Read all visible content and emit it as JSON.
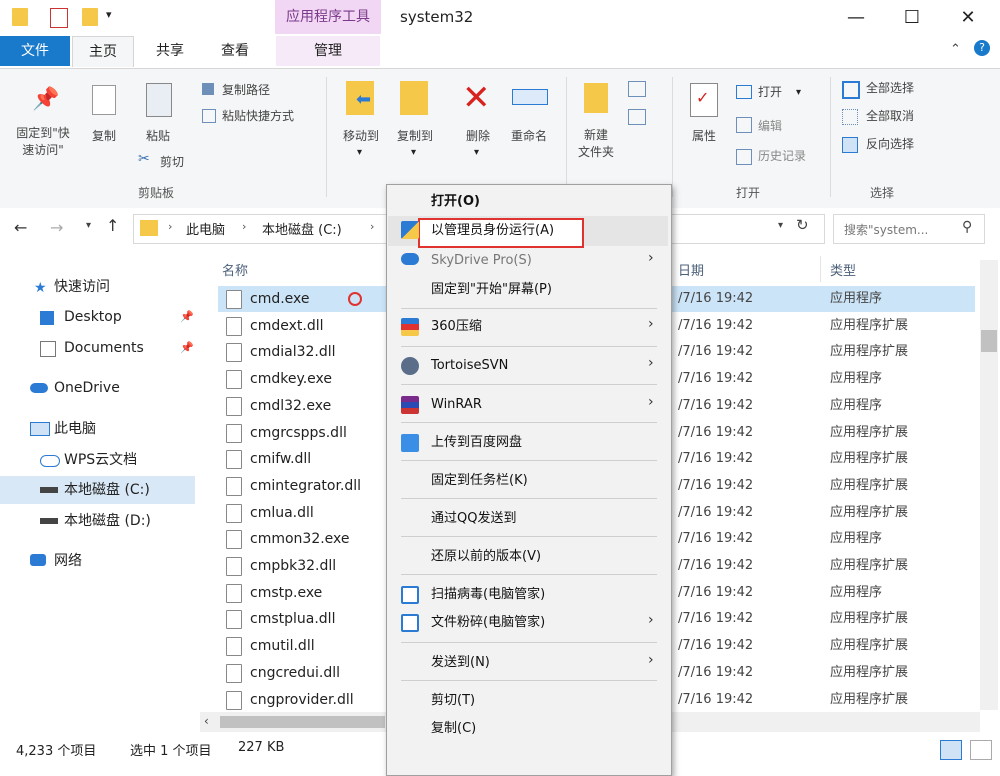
{
  "window": {
    "context_tab_title": "应用程序工具",
    "title": "system32",
    "minimize": "—",
    "maximize": "☐",
    "close": "✕"
  },
  "tabs": {
    "file": "文件",
    "home": "主页",
    "share": "共享",
    "view": "查看",
    "manage": "管理"
  },
  "ribbon": {
    "pin_quick_access": "固定到\"快\n速访问\"",
    "copy": "复制",
    "paste": "粘贴",
    "copy_path": "复制路径",
    "paste_shortcut": "粘贴快捷方式",
    "cut": "剪切",
    "clipboard_group": "剪贴板",
    "move_to": "移动到",
    "copy_to": "复制到",
    "delete": "删除",
    "rename": "重命名",
    "new_folder": "新建\n文件夹",
    "properties": "属性",
    "open": "打开",
    "edit": "编辑",
    "history": "历史记录",
    "open_group": "打开",
    "select_all": "全部选择",
    "select_none": "全部取消",
    "invert_selection": "反向选择",
    "select_group": "选择"
  },
  "address": {
    "crumb_pc": "此电脑",
    "crumb_drive": "本地磁盘 (C:)",
    "search_placeholder": "搜索\"system..."
  },
  "nav": {
    "quick_access": "快速访问",
    "desktop": "Desktop",
    "documents": "Documents",
    "onedrive": "OneDrive",
    "this_pc": "此电脑",
    "wps": "WPS云文档",
    "c_drive": "本地磁盘 (C:)",
    "d_drive": "本地磁盘 (D:)",
    "network": "网络"
  },
  "columns": {
    "name": "名称",
    "date": "日期",
    "type": "类型"
  },
  "files": [
    {
      "name": "cmd.exe",
      "date": "/7/16 19:42",
      "type": "应用程序"
    },
    {
      "name": "cmdext.dll",
      "date": "/7/16 19:42",
      "type": "应用程序扩展"
    },
    {
      "name": "cmdial32.dll",
      "date": "/7/16 19:42",
      "type": "应用程序扩展"
    },
    {
      "name": "cmdkey.exe",
      "date": "/7/16 19:42",
      "type": "应用程序"
    },
    {
      "name": "cmdl32.exe",
      "date": "/7/16 19:42",
      "type": "应用程序"
    },
    {
      "name": "cmgrcspps.dll",
      "date": "/7/16 19:42",
      "type": "应用程序扩展"
    },
    {
      "name": "cmifw.dll",
      "date": "/7/16 19:42",
      "type": "应用程序扩展"
    },
    {
      "name": "cmintegrator.dll",
      "date": "/7/16 19:42",
      "type": "应用程序扩展"
    },
    {
      "name": "cmlua.dll",
      "date": "/7/16 19:42",
      "type": "应用程序扩展"
    },
    {
      "name": "cmmon32.exe",
      "date": "/7/16 19:42",
      "type": "应用程序"
    },
    {
      "name": "cmpbk32.dll",
      "date": "/7/16 19:42",
      "type": "应用程序扩展"
    },
    {
      "name": "cmstp.exe",
      "date": "/7/16 19:42",
      "type": "应用程序"
    },
    {
      "name": "cmstplua.dll",
      "date": "/7/16 19:42",
      "type": "应用程序扩展"
    },
    {
      "name": "cmutil.dll",
      "date": "/7/16 19:42",
      "type": "应用程序扩展"
    },
    {
      "name": "cngcredui.dll",
      "date": "/7/16 19:42",
      "type": "应用程序扩展"
    },
    {
      "name": "cngprovider.dll",
      "date": "/7/16 19:42",
      "type": "应用程序扩展"
    }
  ],
  "menu": {
    "open": "打开(O)",
    "run_as_admin": "以管理员身份运行(A)",
    "skydrive": "SkyDrive Pro(S)",
    "pin_start": "固定到\"开始\"屏幕(P)",
    "zip360": "360压缩",
    "tortoise": "TortoiseSVN",
    "winrar": "WinRAR",
    "baidu": "上传到百度网盘",
    "pin_taskbar": "固定到任务栏(K)",
    "qq_send": "通过QQ发送到",
    "restore": "还原以前的版本(V)",
    "scan": "扫描病毒(电脑管家)",
    "shred": "文件粉碎(电脑管家)",
    "send_to": "发送到(N)",
    "cut": "剪切(T)",
    "copy": "复制(C)"
  },
  "status": {
    "count": "4,233 个项目",
    "selected": "选中 1 个项目",
    "size": "227 KB"
  }
}
